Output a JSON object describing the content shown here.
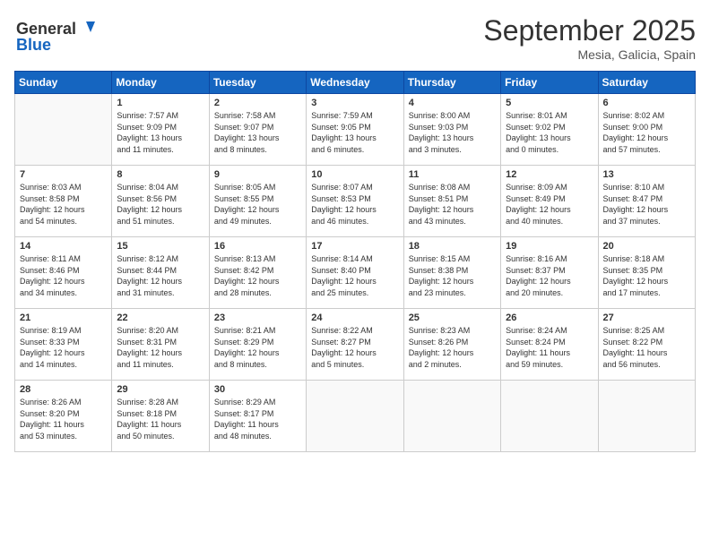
{
  "logo": {
    "line1": "General",
    "line2": "Blue"
  },
  "title": "September 2025",
  "subtitle": "Mesia, Galicia, Spain",
  "days_of_week": [
    "Sunday",
    "Monday",
    "Tuesday",
    "Wednesday",
    "Thursday",
    "Friday",
    "Saturday"
  ],
  "weeks": [
    [
      {
        "day": "",
        "info": ""
      },
      {
        "day": "1",
        "info": "Sunrise: 7:57 AM\nSunset: 9:09 PM\nDaylight: 13 hours\nand 11 minutes."
      },
      {
        "day": "2",
        "info": "Sunrise: 7:58 AM\nSunset: 9:07 PM\nDaylight: 13 hours\nand 8 minutes."
      },
      {
        "day": "3",
        "info": "Sunrise: 7:59 AM\nSunset: 9:05 PM\nDaylight: 13 hours\nand 6 minutes."
      },
      {
        "day": "4",
        "info": "Sunrise: 8:00 AM\nSunset: 9:03 PM\nDaylight: 13 hours\nand 3 minutes."
      },
      {
        "day": "5",
        "info": "Sunrise: 8:01 AM\nSunset: 9:02 PM\nDaylight: 13 hours\nand 0 minutes."
      },
      {
        "day": "6",
        "info": "Sunrise: 8:02 AM\nSunset: 9:00 PM\nDaylight: 12 hours\nand 57 minutes."
      }
    ],
    [
      {
        "day": "7",
        "info": "Sunrise: 8:03 AM\nSunset: 8:58 PM\nDaylight: 12 hours\nand 54 minutes."
      },
      {
        "day": "8",
        "info": "Sunrise: 8:04 AM\nSunset: 8:56 PM\nDaylight: 12 hours\nand 51 minutes."
      },
      {
        "day": "9",
        "info": "Sunrise: 8:05 AM\nSunset: 8:55 PM\nDaylight: 12 hours\nand 49 minutes."
      },
      {
        "day": "10",
        "info": "Sunrise: 8:07 AM\nSunset: 8:53 PM\nDaylight: 12 hours\nand 46 minutes."
      },
      {
        "day": "11",
        "info": "Sunrise: 8:08 AM\nSunset: 8:51 PM\nDaylight: 12 hours\nand 43 minutes."
      },
      {
        "day": "12",
        "info": "Sunrise: 8:09 AM\nSunset: 8:49 PM\nDaylight: 12 hours\nand 40 minutes."
      },
      {
        "day": "13",
        "info": "Sunrise: 8:10 AM\nSunset: 8:47 PM\nDaylight: 12 hours\nand 37 minutes."
      }
    ],
    [
      {
        "day": "14",
        "info": "Sunrise: 8:11 AM\nSunset: 8:46 PM\nDaylight: 12 hours\nand 34 minutes."
      },
      {
        "day": "15",
        "info": "Sunrise: 8:12 AM\nSunset: 8:44 PM\nDaylight: 12 hours\nand 31 minutes."
      },
      {
        "day": "16",
        "info": "Sunrise: 8:13 AM\nSunset: 8:42 PM\nDaylight: 12 hours\nand 28 minutes."
      },
      {
        "day": "17",
        "info": "Sunrise: 8:14 AM\nSunset: 8:40 PM\nDaylight: 12 hours\nand 25 minutes."
      },
      {
        "day": "18",
        "info": "Sunrise: 8:15 AM\nSunset: 8:38 PM\nDaylight: 12 hours\nand 23 minutes."
      },
      {
        "day": "19",
        "info": "Sunrise: 8:16 AM\nSunset: 8:37 PM\nDaylight: 12 hours\nand 20 minutes."
      },
      {
        "day": "20",
        "info": "Sunrise: 8:18 AM\nSunset: 8:35 PM\nDaylight: 12 hours\nand 17 minutes."
      }
    ],
    [
      {
        "day": "21",
        "info": "Sunrise: 8:19 AM\nSunset: 8:33 PM\nDaylight: 12 hours\nand 14 minutes."
      },
      {
        "day": "22",
        "info": "Sunrise: 8:20 AM\nSunset: 8:31 PM\nDaylight: 12 hours\nand 11 minutes."
      },
      {
        "day": "23",
        "info": "Sunrise: 8:21 AM\nSunset: 8:29 PM\nDaylight: 12 hours\nand 8 minutes."
      },
      {
        "day": "24",
        "info": "Sunrise: 8:22 AM\nSunset: 8:27 PM\nDaylight: 12 hours\nand 5 minutes."
      },
      {
        "day": "25",
        "info": "Sunrise: 8:23 AM\nSunset: 8:26 PM\nDaylight: 12 hours\nand 2 minutes."
      },
      {
        "day": "26",
        "info": "Sunrise: 8:24 AM\nSunset: 8:24 PM\nDaylight: 11 hours\nand 59 minutes."
      },
      {
        "day": "27",
        "info": "Sunrise: 8:25 AM\nSunset: 8:22 PM\nDaylight: 11 hours\nand 56 minutes."
      }
    ],
    [
      {
        "day": "28",
        "info": "Sunrise: 8:26 AM\nSunset: 8:20 PM\nDaylight: 11 hours\nand 53 minutes."
      },
      {
        "day": "29",
        "info": "Sunrise: 8:28 AM\nSunset: 8:18 PM\nDaylight: 11 hours\nand 50 minutes."
      },
      {
        "day": "30",
        "info": "Sunrise: 8:29 AM\nSunset: 8:17 PM\nDaylight: 11 hours\nand 48 minutes."
      },
      {
        "day": "",
        "info": ""
      },
      {
        "day": "",
        "info": ""
      },
      {
        "day": "",
        "info": ""
      },
      {
        "day": "",
        "info": ""
      }
    ]
  ]
}
